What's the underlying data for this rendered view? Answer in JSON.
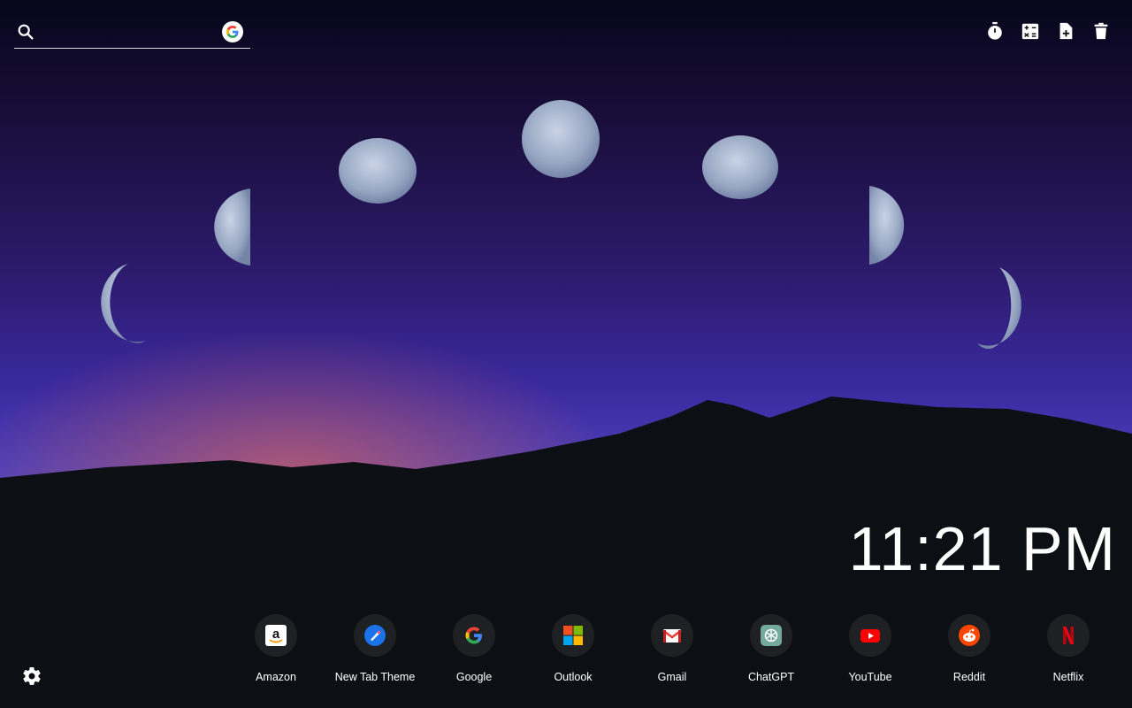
{
  "search": {
    "value": "",
    "placeholder": ""
  },
  "clock": {
    "time": "11:21 PM"
  },
  "shortcuts": [
    {
      "label": "Amazon",
      "icon": "amazon-icon"
    },
    {
      "label": "New Tab Theme",
      "icon": "new-tab-theme-icon"
    },
    {
      "label": "Google",
      "icon": "google-icon"
    },
    {
      "label": "Outlook",
      "icon": "outlook-icon"
    },
    {
      "label": "Gmail",
      "icon": "gmail-icon"
    },
    {
      "label": "ChatGPT",
      "icon": "chatgpt-icon"
    },
    {
      "label": "YouTube",
      "icon": "youtube-icon"
    },
    {
      "label": "Reddit",
      "icon": "reddit-icon"
    },
    {
      "label": "Netflix",
      "icon": "netflix-icon"
    }
  ],
  "toolbar": {
    "icons": [
      "timer-icon",
      "calculator-icon",
      "add-note-icon",
      "trash-icon"
    ]
  },
  "colors": {
    "youtube": "#ff0000",
    "netflix": "#e50914",
    "reddit": "#ff4500",
    "amazon": "#ff9900"
  }
}
